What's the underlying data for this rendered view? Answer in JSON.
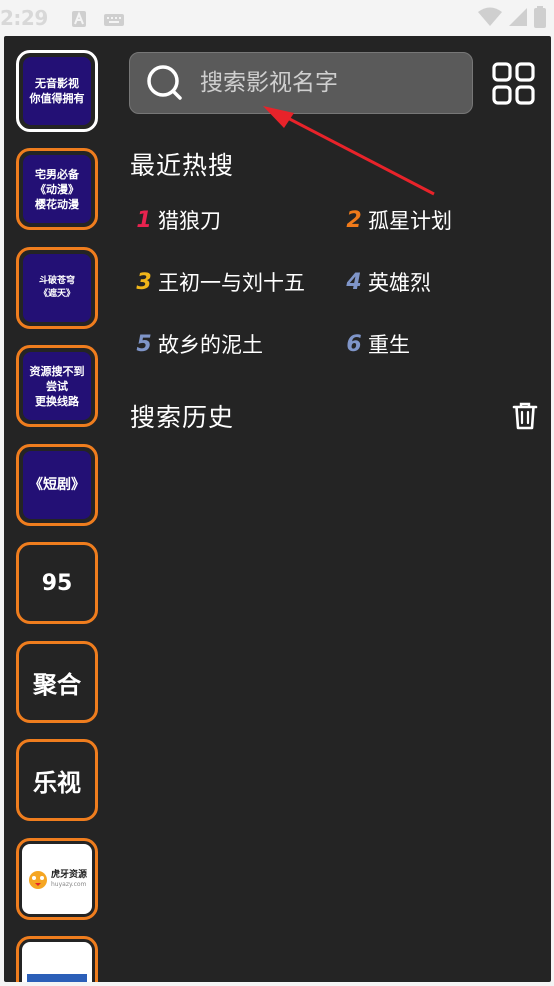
{
  "status_bar": {
    "time": "2:29",
    "icons": [
      "font-a-icon",
      "keyboard-icon",
      "wifi-icon",
      "signal-icon",
      "battery-icon"
    ]
  },
  "sidebar": {
    "items": [
      {
        "label": "无音影视\n你值得拥有",
        "style": "tile",
        "active": true
      },
      {
        "label": "宅男必备\n《动漫》\n樱花动漫",
        "style": "tile"
      },
      {
        "label": "斗破苍穹\n《遮天》",
        "style": "tile-small"
      },
      {
        "label": "资源搜不到\n尝试\n更换线路",
        "style": "tile"
      },
      {
        "label": "《短剧》",
        "style": "tile"
      },
      {
        "label": "95",
        "style": "plain"
      },
      {
        "label": "聚合",
        "style": "plain"
      },
      {
        "label": "乐视",
        "style": "plain"
      },
      {
        "label": "虎牙资源",
        "sublabel": "huyazy.com",
        "style": "logo"
      },
      {
        "label": "",
        "style": "logo-partial"
      }
    ]
  },
  "search": {
    "placeholder": "搜索影视名字",
    "value": ""
  },
  "hot_search": {
    "title": "最近热搜",
    "items": [
      {
        "rank": "1",
        "title": "猎狼刀",
        "color": "#e8234f"
      },
      {
        "rank": "2",
        "title": "孤星计划",
        "color": "#f07a1a"
      },
      {
        "rank": "3",
        "title": "王初一与刘十五",
        "color": "#f0b61a"
      },
      {
        "rank": "4",
        "title": "英雄烈",
        "color": "#7f95c8"
      },
      {
        "rank": "5",
        "title": "故乡的泥土",
        "color": "#7f95c8"
      },
      {
        "rank": "6",
        "title": "重生",
        "color": "#7f95c8"
      }
    ]
  },
  "history": {
    "title": "搜索历史"
  },
  "colors": {
    "background": "#242424",
    "accent_border": "#ef7d1e",
    "tile": "#231075",
    "annotation_arrow": "#e8232a"
  }
}
